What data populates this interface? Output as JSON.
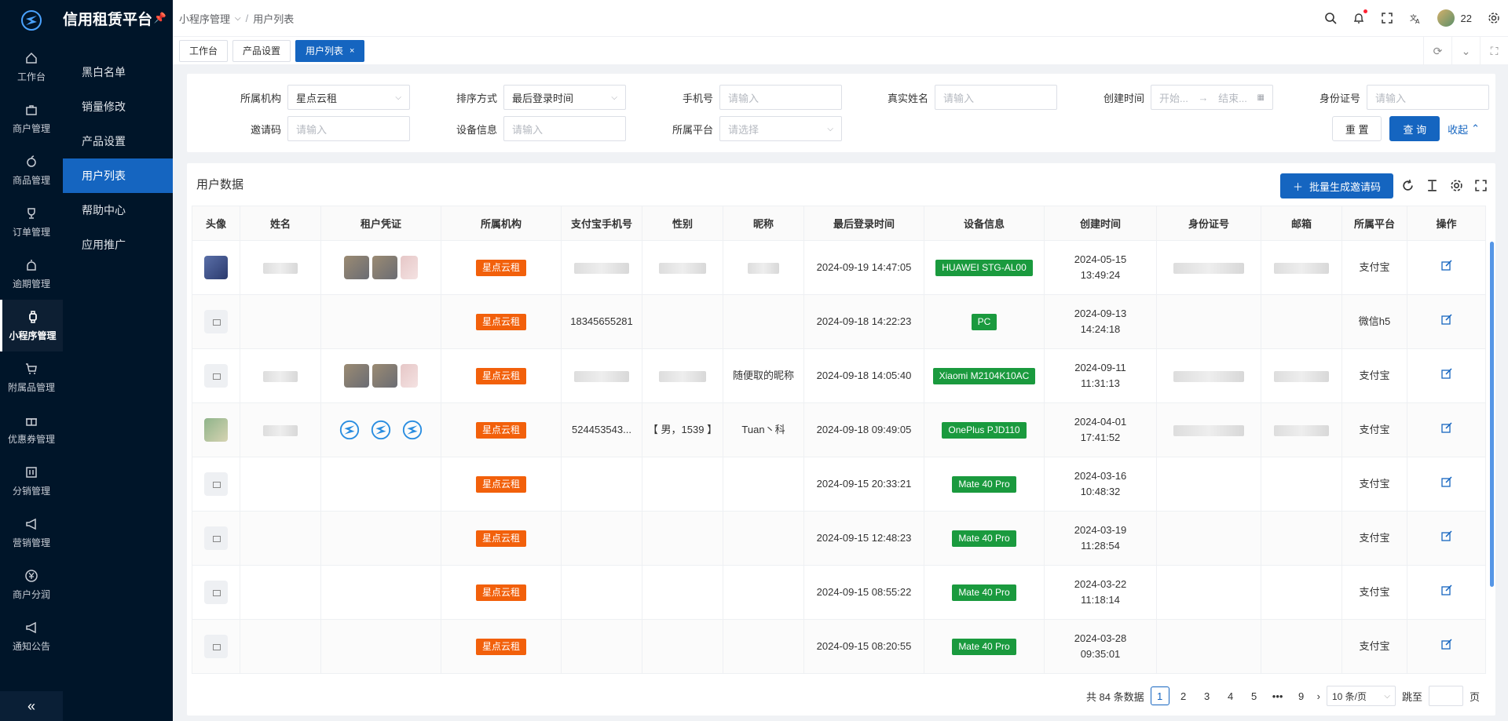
{
  "brand": {
    "title": "信用租赁平台"
  },
  "rail": [
    {
      "label": "工作台",
      "icon": "home-icon"
    },
    {
      "label": "商户管理",
      "icon": "briefcase-icon"
    },
    {
      "label": "商品管理",
      "icon": "apple-icon"
    },
    {
      "label": "订单管理",
      "icon": "trophy-icon"
    },
    {
      "label": "逾期管理",
      "icon": "alarm-icon"
    },
    {
      "label": "小程序管理",
      "icon": "watch-icon",
      "active": true
    },
    {
      "label": "附属品管理",
      "icon": "cart-icon"
    },
    {
      "label": "优惠券管理",
      "icon": "gift-icon"
    },
    {
      "label": "分销管理",
      "icon": "calendar-icon"
    },
    {
      "label": "营销管理",
      "icon": "megaphone-icon"
    },
    {
      "label": "商户分润",
      "icon": "yen-icon"
    },
    {
      "label": "通知公告",
      "icon": "bell-icon"
    }
  ],
  "submenu": [
    "黑白名单",
    "销量修改",
    "产品设置",
    "用户列表",
    "帮助中心",
    "应用推广"
  ],
  "breadcrumb": {
    "parent": "小程序管理",
    "current": "用户列表"
  },
  "user": {
    "name": "22"
  },
  "tabs": [
    "工作台",
    "产品设置",
    "用户列表"
  ],
  "filters": {
    "org": {
      "label": "所属机构",
      "value": "星点云租"
    },
    "sort": {
      "label": "排序方式",
      "value": "最后登录时间"
    },
    "phone": {
      "label": "手机号",
      "placeholder": "请输入"
    },
    "realname": {
      "label": "真实姓名",
      "placeholder": "请输入"
    },
    "created": {
      "label": "创建时间",
      "start": "开始...",
      "end": "结束..."
    },
    "idcard": {
      "label": "身份证号",
      "placeholder": "请输入"
    },
    "invite": {
      "label": "邀请码",
      "placeholder": "请输入"
    },
    "device": {
      "label": "设备信息",
      "placeholder": "请输入"
    },
    "platform": {
      "label": "所属平台",
      "placeholder": "请选择"
    },
    "reset": "重 置",
    "query": "查 询",
    "collapse": "收起"
  },
  "table": {
    "title": "用户数据",
    "batch_button": "批量生成邀请码",
    "columns": [
      "头像",
      "姓名",
      "租户凭证",
      "所属机构",
      "支付宝手机号",
      "性别",
      "昵称",
      "最后登录时间",
      "设备信息",
      "创建时间",
      "身份证号",
      "邮箱",
      "所属平台",
      "操作"
    ],
    "rows": [
      {
        "avatar": "img1",
        "name": "",
        "cred": "blur",
        "org": "星点云租",
        "phone": "",
        "gender": "",
        "nick": "",
        "last": "2024-09-19 14:47:05",
        "device": "HUAWEI STG-AL00",
        "created": "2024-05-15 13:49:24",
        "platform": "支付宝"
      },
      {
        "avatar": "ph",
        "name": "",
        "cred": "",
        "org": "星点云租",
        "phone": "18345655281",
        "gender": "",
        "nick": "",
        "last": "2024-09-18 14:22:23",
        "device": "PC",
        "created": "2024-09-13 14:24:18",
        "platform": "微信h5"
      },
      {
        "avatar": "ph",
        "name": "",
        "cred": "blur",
        "org": "星点云租",
        "phone": "",
        "gender": "",
        "nick": "随便取的昵称",
        "last": "2024-09-18 14:05:40",
        "device": "Xiaomi M2104K10AC",
        "created": "2024-09-11 11:31:13",
        "platform": "支付宝"
      },
      {
        "avatar": "img2",
        "name": "",
        "cred": "logos",
        "org": "星点云租",
        "phone": "524453543...",
        "gender": "【 男，1539 】",
        "nick": "Tuan丶科",
        "last": "2024-09-18 09:49:05",
        "device": "OnePlus PJD110",
        "created": "2024-04-01 17:41:52",
        "platform": "支付宝"
      },
      {
        "avatar": "ph",
        "name": "",
        "cred": "",
        "org": "星点云租",
        "phone": "",
        "gender": "",
        "nick": "",
        "last": "2024-09-15 20:33:21",
        "device": "Mate 40 Pro",
        "created": "2024-03-16 10:48:32",
        "platform": "支付宝"
      },
      {
        "avatar": "ph",
        "name": "",
        "cred": "",
        "org": "星点云租",
        "phone": "",
        "gender": "",
        "nick": "",
        "last": "2024-09-15 12:48:23",
        "device": "Mate 40 Pro",
        "created": "2024-03-19 11:28:54",
        "platform": "支付宝"
      },
      {
        "avatar": "ph",
        "name": "",
        "cred": "",
        "org": "星点云租",
        "phone": "",
        "gender": "",
        "nick": "",
        "last": "2024-09-15 08:55:22",
        "device": "Mate 40 Pro",
        "created": "2024-03-22 11:18:14",
        "platform": "支付宝"
      },
      {
        "avatar": "ph",
        "name": "",
        "cred": "",
        "org": "星点云租",
        "phone": "",
        "gender": "",
        "nick": "",
        "last": "2024-09-15 08:20:55",
        "device": "Mate 40 Pro",
        "created": "2024-03-28 09:35:01",
        "platform": "支付宝"
      }
    ]
  },
  "pagination": {
    "total": "共 84 条数据",
    "pages": [
      "1",
      "2",
      "3",
      "4",
      "5",
      "•••",
      "9"
    ],
    "current": "1",
    "size": "10 条/页",
    "jump_label": "跳至",
    "page_suffix": "页"
  },
  "colors": {
    "primary": "#1565c0",
    "org_tag": "#f2600b",
    "device_tag": "#1a9a3e",
    "sidebar": "#001529"
  }
}
